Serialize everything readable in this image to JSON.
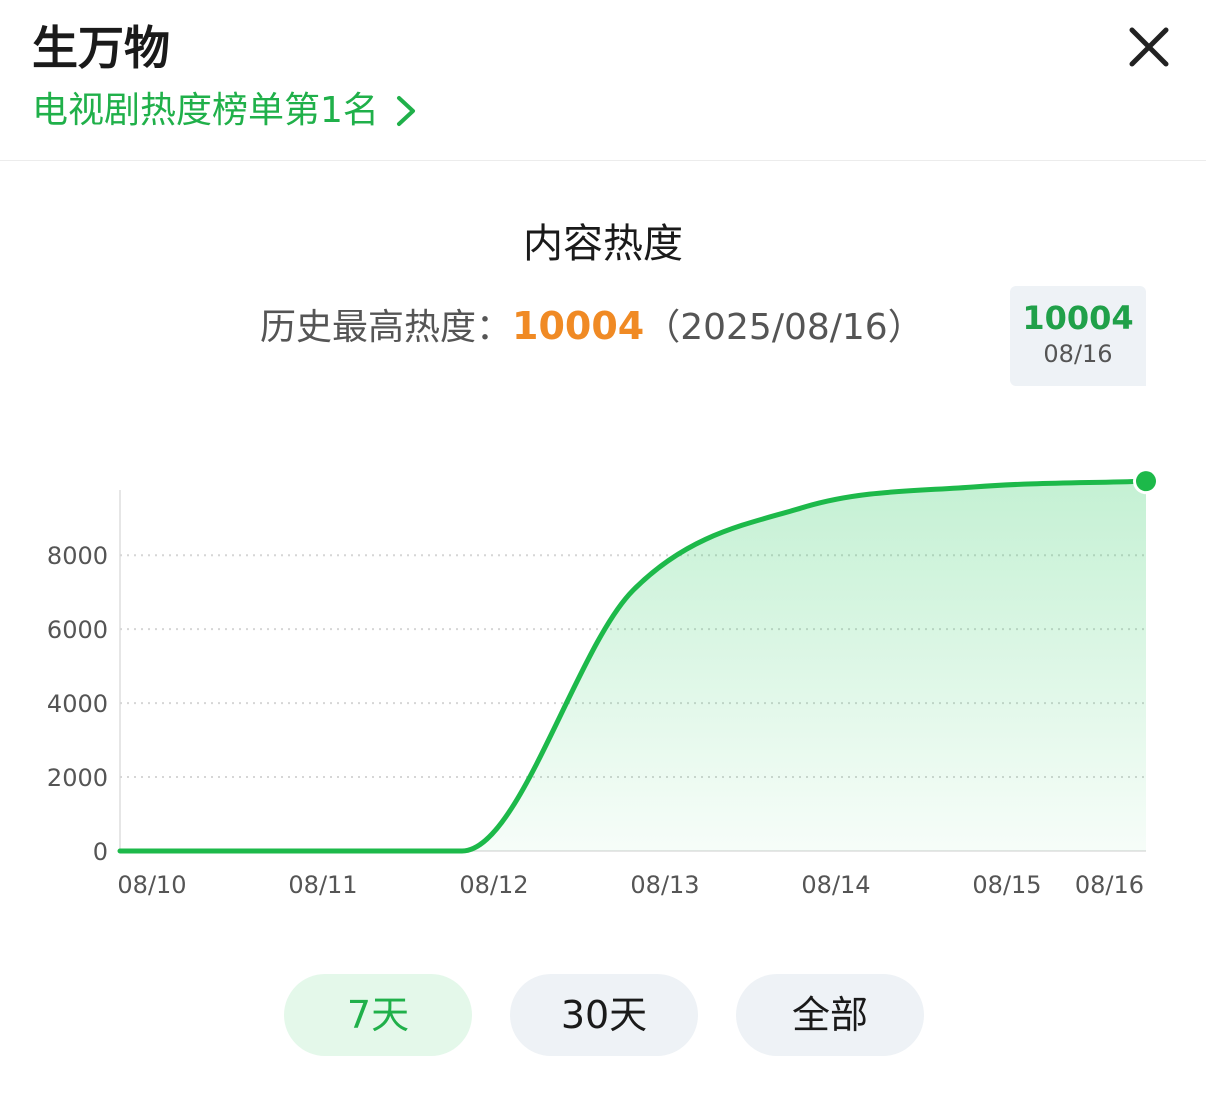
{
  "header": {
    "title": "生万物",
    "rank_link": "电视剧热度榜单第1名"
  },
  "card": {
    "title": "内容热度",
    "max_label": "历史最高热度：",
    "max_value": "10004",
    "max_date": "（2025/08/16）"
  },
  "tooltip": {
    "value": "10004",
    "date": "08/16"
  },
  "chart_data": {
    "type": "area",
    "x": [
      "08/10",
      "08/11",
      "08/12",
      "08/13",
      "08/14",
      "08/15",
      "08/16"
    ],
    "categories": [
      "08/10",
      "08/11",
      "08/12",
      "08/13",
      "08/14",
      "08/15",
      "08/16"
    ],
    "series": [
      {
        "values": [
          0,
          0,
          0,
          7050,
          9300,
          9850,
          10004
        ]
      }
    ],
    "y_ticks": [
      "0",
      "2000",
      "4000",
      "6000",
      "8000"
    ],
    "ylim": [
      0,
      10004
    ],
    "grid": true,
    "highlight_index": 6,
    "colors": {
      "line": "#1db94a",
      "fill": "#2ecc64",
      "grid": "#d6d6d6"
    }
  },
  "ranges": [
    {
      "label": "7天",
      "active": true
    },
    {
      "label": "30天",
      "active": false
    },
    {
      "label": "全部",
      "active": false
    }
  ]
}
